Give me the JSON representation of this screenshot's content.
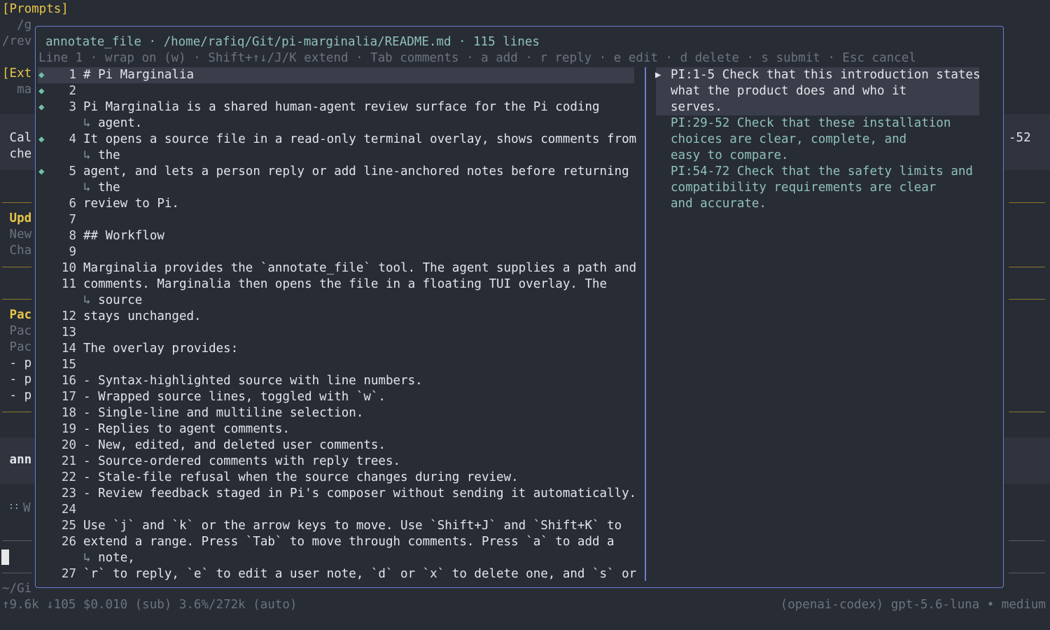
{
  "background": {
    "prompts_header": "[Prompts]",
    "prompt_line1": "  /g",
    "prompt_line2": "/rev",
    "ext_header": "[Ext",
    "ext_line": "  ma",
    "call_line1": " Cal",
    "call_line2": " che",
    "call_right": "-52",
    "update_header": " Upd",
    "update_line1": " New",
    "update_line2": " Cha",
    "pac_header": " Pac",
    "pac_line1": " Pac",
    "pac_line2": " Pac",
    "list1": " - p",
    "list2": " - p",
    "list3": " - p",
    "ann_line": " ann",
    "working_dots": "::",
    "working_text": "W",
    "cwd": "~/Gi"
  },
  "status_bar": {
    "left": "↑9.6k ↓105 $0.010 (sub) 3.6%/272k (auto)",
    "right": "(openai-codex) gpt-5.6-luna • medium"
  },
  "overlay": {
    "title": "annotate_file · /home/rafiq/Git/pi-marginalia/README.md · 115 lines",
    "help": "Line 1 · wrap on (w) · Shift+↑↓/J/K extend · Tab comments · a add · r reply · e edit · d delete · s submit · Esc cancel",
    "wrap_marker": "↳",
    "rows": [
      {
        "num": "1",
        "text": "# Pi Marginalia",
        "mark": true
      },
      {
        "num": "2",
        "text": "",
        "mark": true
      },
      {
        "num": "3",
        "text": "Pi Marginalia is a shared human-agent review surface for the Pi coding",
        "mark": true
      },
      {
        "num": "",
        "text": "agent.",
        "wrap": true
      },
      {
        "num": "4",
        "text": "It opens a source file in a read-only terminal overlay, shows comments from",
        "mark": true
      },
      {
        "num": "",
        "text": "the",
        "wrap": true
      },
      {
        "num": "5",
        "text": "agent, and lets a person reply or add line-anchored notes before returning",
        "mark": true
      },
      {
        "num": "",
        "text": "the",
        "wrap": true
      },
      {
        "num": "6",
        "text": "review to Pi."
      },
      {
        "num": "7",
        "text": ""
      },
      {
        "num": "8",
        "text": "## Workflow"
      },
      {
        "num": "9",
        "text": ""
      },
      {
        "num": "10",
        "text": "Marginalia provides the `annotate_file` tool. The agent supplies a path and"
      },
      {
        "num": "11",
        "text": "comments. Marginalia then opens the file in a floating TUI overlay. The"
      },
      {
        "num": "",
        "text": "source",
        "wrap": true
      },
      {
        "num": "12",
        "text": "stays unchanged."
      },
      {
        "num": "13",
        "text": ""
      },
      {
        "num": "14",
        "text": "The overlay provides:"
      },
      {
        "num": "15",
        "text": ""
      },
      {
        "num": "16",
        "text": "- Syntax-highlighted source with line numbers."
      },
      {
        "num": "17",
        "text": "- Wrapped source lines, toggled with `w`."
      },
      {
        "num": "18",
        "text": "- Single-line and multiline selection."
      },
      {
        "num": "19",
        "text": "- Replies to agent comments."
      },
      {
        "num": "20",
        "text": "- New, edited, and deleted user comments."
      },
      {
        "num": "21",
        "text": "- Source-ordered comments with reply trees."
      },
      {
        "num": "22",
        "text": "- Stale-file refusal when the source changes during review."
      },
      {
        "num": "23",
        "text": "- Review feedback staged in Pi's composer without sending it automatically."
      },
      {
        "num": "24",
        "text": ""
      },
      {
        "num": "25",
        "text": "Use `j` and `k` or the arrow keys to move. Use `Shift+J` and `Shift+K` to"
      },
      {
        "num": "26",
        "text": "extend a range. Press `Tab` to move through comments. Press `a` to add a"
      },
      {
        "num": "",
        "text": "note,",
        "wrap": true
      },
      {
        "num": "27",
        "text": "`r` to reply, `e` to edit a user note, `d` or `x` to delete one, and `s` or"
      }
    ],
    "comments": [
      {
        "active": true,
        "pointer": "▶",
        "lines": [
          "PI:1-5 Check that this introduction states",
          "what the product does and who it",
          "serves."
        ]
      },
      {
        "active": false,
        "pointer": "",
        "lines": [
          "PI:29-52 Check that these installation",
          "choices are clear, complete, and",
          "easy to compare."
        ]
      },
      {
        "active": false,
        "pointer": "",
        "lines": [
          "PI:54-72 Check that the safety limits and",
          "compatibility requirements are clear",
          "and accurate."
        ]
      }
    ]
  },
  "colors": {
    "background": "#282c35",
    "border": "#6a7fd0",
    "accent_yellow": "#e7c547",
    "comment_teal": "#8fc2b8",
    "marker_green": "#72c0a8"
  }
}
